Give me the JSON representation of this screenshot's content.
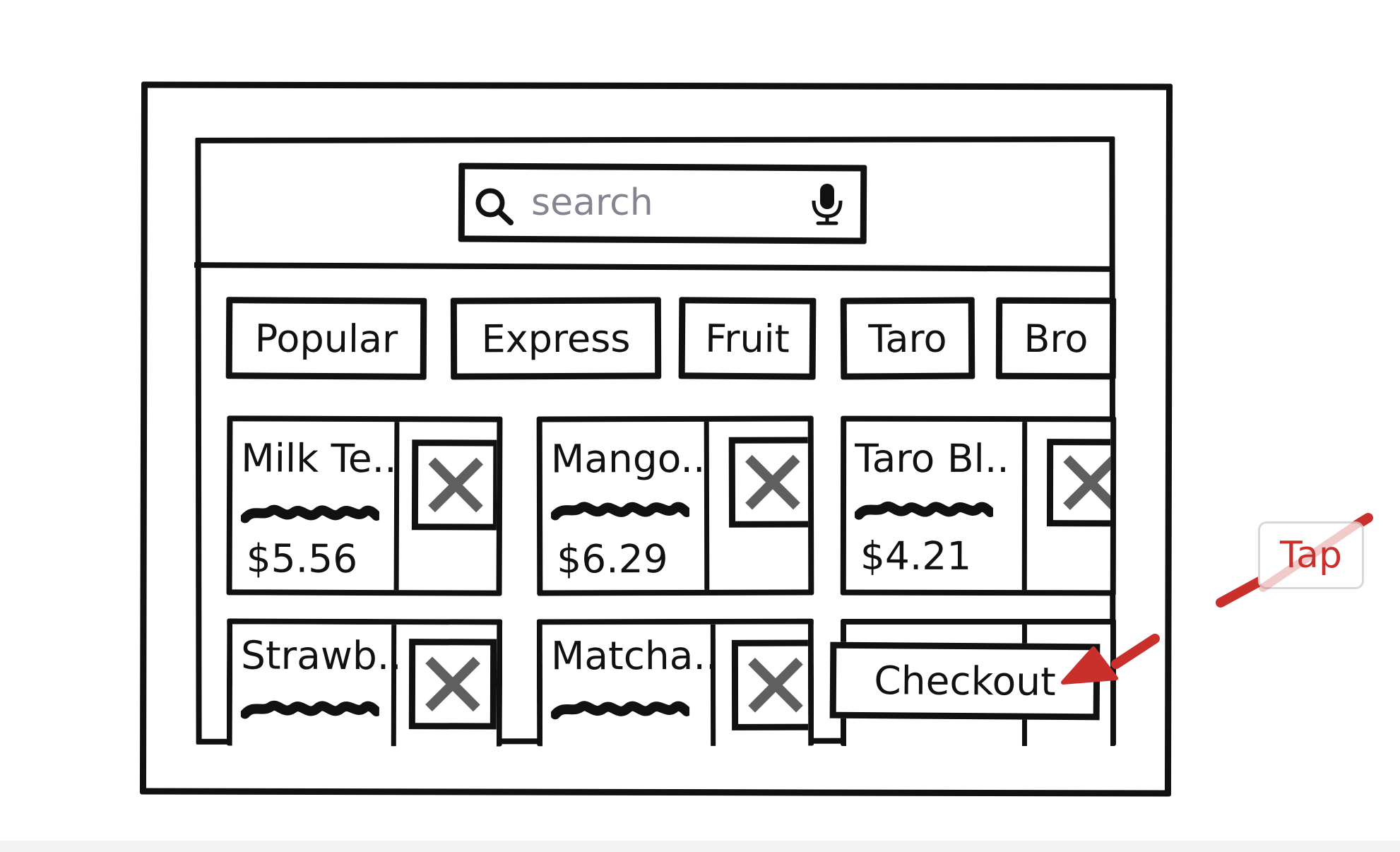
{
  "search": {
    "placeholder": "search",
    "value": "",
    "search_icon": "search-icon",
    "mic_icon": "microphone-icon"
  },
  "categories": [
    {
      "label": "Popular"
    },
    {
      "label": "Express"
    },
    {
      "label": "Fruit"
    },
    {
      "label": "Taro"
    },
    {
      "label": "Bro"
    }
  ],
  "products": [
    {
      "name": "Milk Te..",
      "price": "$5.56",
      "image": "placeholder-image-icon"
    },
    {
      "name": "Mango..",
      "price": "$6.29",
      "image": "placeholder-image-icon"
    },
    {
      "name": "Taro Bl..",
      "price": "$4.21",
      "image": "placeholder-image-icon"
    },
    {
      "name": "Strawb..",
      "price": "",
      "image": "placeholder-image-icon"
    },
    {
      "name": "Matcha..",
      "price": "",
      "image": "placeholder-image-icon"
    }
  ],
  "checkout": {
    "label": "Checkout"
  },
  "annotation": {
    "label": "Tap",
    "color": "#c9302c"
  }
}
